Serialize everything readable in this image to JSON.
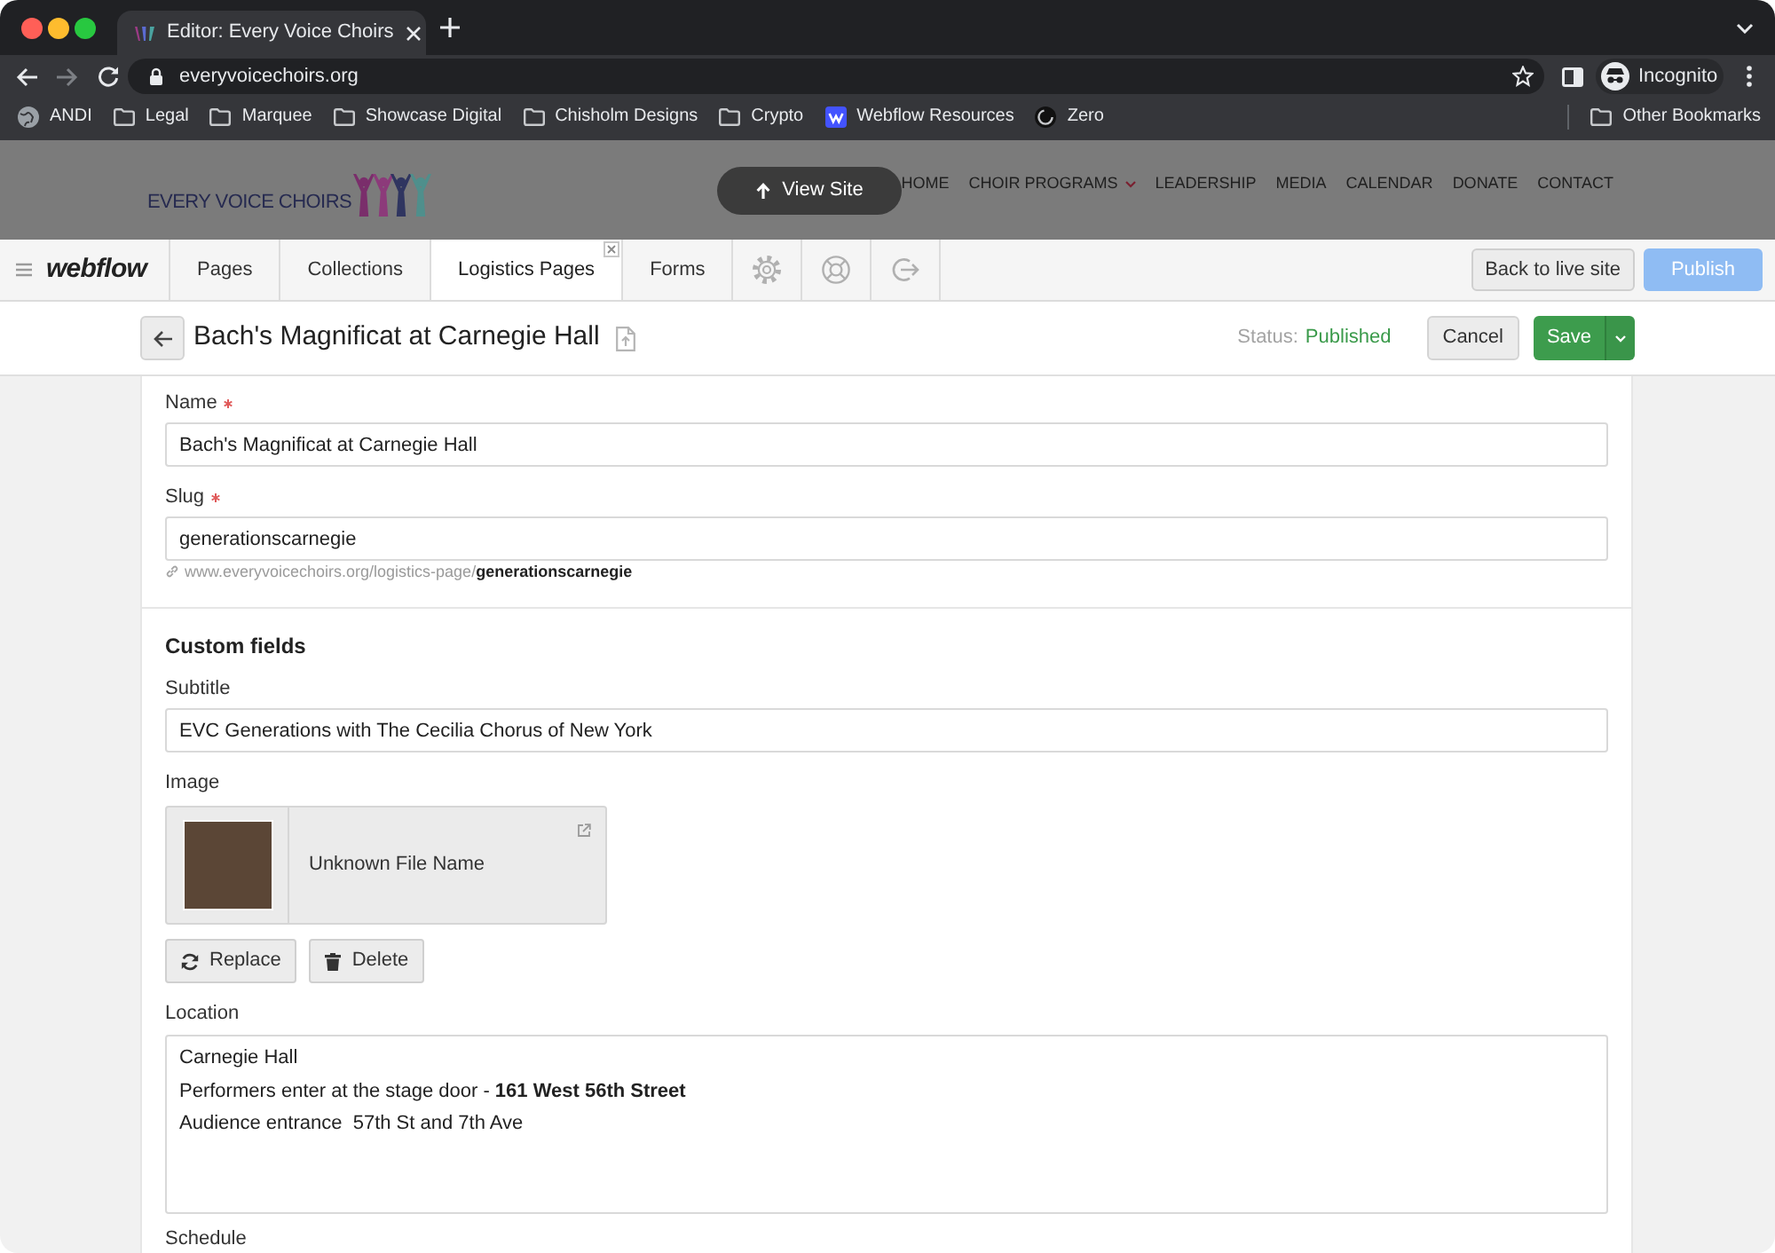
{
  "browser": {
    "tabs": [
      {
        "title": "Editor: Every Voice Choirs",
        "selected": true
      }
    ],
    "address": "everyvoicechoirs.org",
    "profile": "Incognito",
    "bookmarks": [
      {
        "kind": "globe",
        "label": "ANDI"
      },
      {
        "kind": "folder",
        "label": "Legal"
      },
      {
        "kind": "folder",
        "label": "Marquee"
      },
      {
        "kind": "folder",
        "label": "Showcase Digital"
      },
      {
        "kind": "folder",
        "label": "Chisholm Designs"
      },
      {
        "kind": "folder",
        "label": "Crypto"
      },
      {
        "kind": "tile",
        "label": "Webflow Resources"
      },
      {
        "kind": "ring",
        "label": "Zero"
      }
    ],
    "other_bookmarks": {
      "kind": "folder",
      "label": "Other Bookmarks"
    }
  },
  "site_preview": {
    "logo_text": "EVERY VOICE CHOIRS",
    "view_site_button": "View Site",
    "nav": [
      {
        "label": "HOME",
        "has_menu": false
      },
      {
        "label": "CHOIR PROGRAMS",
        "has_menu": true
      },
      {
        "label": "LEADERSHIP",
        "has_menu": false
      },
      {
        "label": "MEDIA",
        "has_menu": false
      },
      {
        "label": "CALENDAR",
        "has_menu": false
      },
      {
        "label": "DONATE",
        "has_menu": false
      },
      {
        "label": "CONTACT",
        "has_menu": false
      }
    ]
  },
  "editor_bar": {
    "logo": "webflow",
    "tabs": [
      {
        "label": "Pages",
        "selected": false,
        "closable": false
      },
      {
        "label": "Collections",
        "selected": false,
        "closable": false
      },
      {
        "label": "Logistics Pages",
        "selected": true,
        "closable": true
      },
      {
        "label": "Forms",
        "selected": false,
        "closable": false
      }
    ],
    "back_button": "Back to live site",
    "publish_button": {
      "label": "Publish",
      "disabled": true
    }
  },
  "item_header": {
    "title": "Bach's Magnificat at Carnegie Hall",
    "status_label": "Status:",
    "status": "Published",
    "cancel_button": "Cancel",
    "save_button": "Save"
  },
  "form": {
    "fields": [
      {
        "kind": "text",
        "label": "Name",
        "required": true,
        "value": "Bach's Magnificat at Carnegie Hall"
      },
      {
        "kind": "slug",
        "label": "Slug",
        "required": true,
        "value": "generationscarnegie",
        "url": "www.everyvoicechoirs.org/logistics-page/**generationscarnegie**"
      }
    ],
    "custom_fields": {
      "title": "Custom fields",
      "fields": [
        {
          "kind": "text",
          "label": "Subtitle",
          "required": false,
          "value": "EVC Generations with The Cecilia Chorus of New York"
        },
        {
          "kind": "image",
          "label": "Image",
          "required": false,
          "file_name": "Unknown File Name",
          "buttons": [
            {
              "kind": "replace",
              "label": "Replace"
            },
            {
              "kind": "delete",
              "label": "Delete"
            }
          ]
        },
        {
          "kind": "rich_text",
          "label": "Location",
          "required": false,
          "lines": [
            "Carnegie Hall",
            "Performers enter at the stage door - **161 West 56th Street**",
            "Audience entrance  57th St and 7th Ave"
          ]
        },
        {
          "kind": "label_only",
          "label": "Schedule",
          "required": false
        }
      ]
    }
  }
}
